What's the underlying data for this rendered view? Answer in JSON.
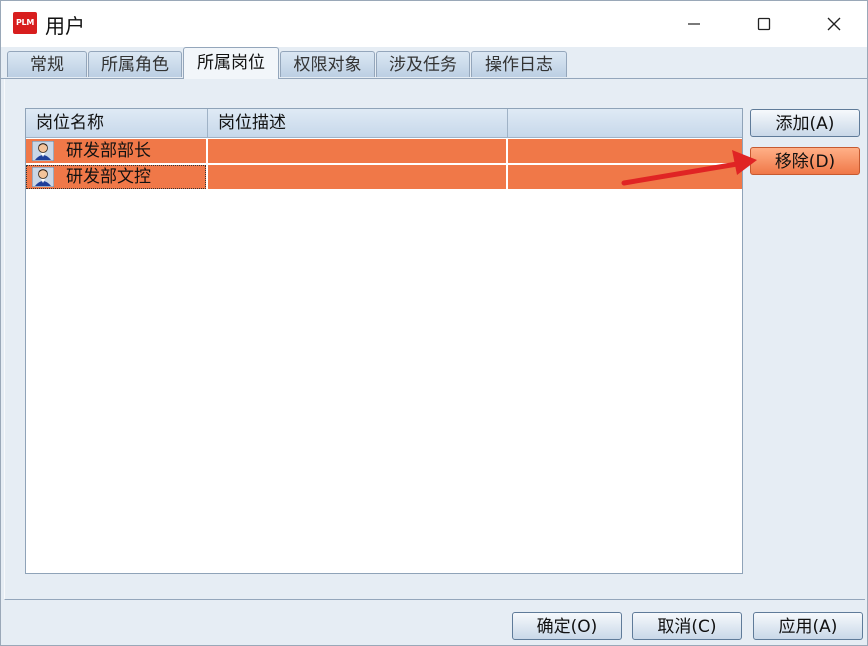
{
  "window": {
    "app_icon_text": "PLM",
    "title": "用户"
  },
  "tabs": [
    {
      "label": "常规",
      "active": false
    },
    {
      "label": "所属角色",
      "active": false
    },
    {
      "label": "所属岗位",
      "active": true
    },
    {
      "label": "权限对象",
      "active": false
    },
    {
      "label": "涉及任务",
      "active": false
    },
    {
      "label": "操作日志",
      "active": false
    }
  ],
  "list": {
    "columns": [
      "岗位名称",
      "岗位描述",
      ""
    ],
    "rows": [
      {
        "name": "研发部部长",
        "description": "",
        "extra": "",
        "icon": "user-icon"
      },
      {
        "name": "研发部文控",
        "description": "",
        "extra": "",
        "icon": "user-icon"
      }
    ],
    "selected_color": "#f07848"
  },
  "side_buttons": {
    "add_label": "添加(A)",
    "remove_label": "移除(D)"
  },
  "bottom_buttons": {
    "ok_label": "确定(O)",
    "cancel_label": "取消(C)",
    "apply_label": "应用(A)"
  },
  "annotation": {
    "arrow_color": "#e02424"
  }
}
